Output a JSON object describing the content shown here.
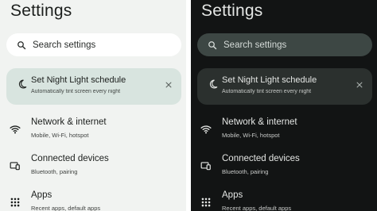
{
  "light": {
    "title": "Settings",
    "search": {
      "placeholder": "Search settings",
      "icon": "search-icon"
    },
    "suggestion": {
      "title": "Set Night Light schedule",
      "subtitle": "Automatically tint screen every night",
      "icon": "moon-icon",
      "dismiss_icon": "close-icon"
    },
    "items": [
      {
        "title": "Network & internet",
        "subtitle": "Mobile, Wi-Fi, hotspot",
        "icon": "wifi-icon"
      },
      {
        "title": "Connected devices",
        "subtitle": "Bluetooth, pairing",
        "icon": "devices-icon"
      },
      {
        "title": "Apps",
        "subtitle": "Recent apps, default apps",
        "icon": "apps-grid-icon"
      }
    ]
  },
  "dark": {
    "title": "Settings",
    "search": {
      "placeholder": "Search settings",
      "icon": "search-icon"
    },
    "suggestion": {
      "title": "Set Night Light schedule",
      "subtitle": "Automatically tint screen every night",
      "icon": "moon-icon",
      "dismiss_icon": "close-icon"
    },
    "items": [
      {
        "title": "Network & internet",
        "subtitle": "Mobile, Wi-Fi, hotspot",
        "icon": "wifi-icon"
      },
      {
        "title": "Connected devices",
        "subtitle": "Bluetooth, pairing",
        "icon": "devices-icon"
      },
      {
        "title": "Apps",
        "subtitle": "Recent apps, default apps",
        "icon": "apps-grid-icon"
      }
    ]
  },
  "colors": {
    "light_background": "#f1f3f1",
    "light_card": "#d8e4df",
    "light_search": "#ffffff",
    "dark_background": "#121414",
    "dark_card": "#2b302e",
    "dark_search": "#3d4744"
  }
}
